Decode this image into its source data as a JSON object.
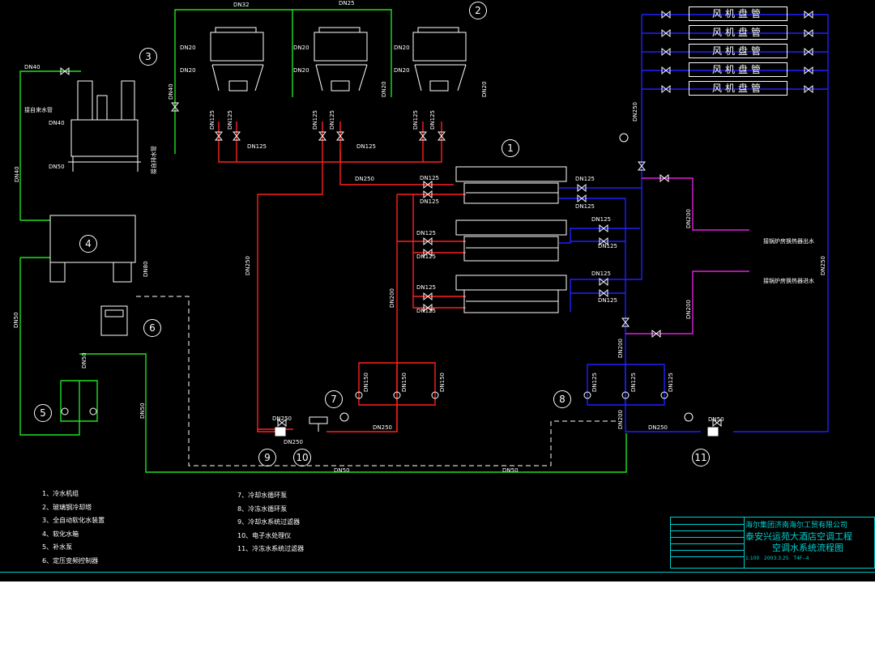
{
  "pipe_colors": {
    "cooling": "#ff2020",
    "chilled": "#2020ff",
    "makeup": "#20e020",
    "heat_exchanger": "#e020e0",
    "control": "#ffffff"
  },
  "pipe_labels": {
    "dn32": "DN32",
    "dn25_top": "DN25",
    "dn40_a": "DN40",
    "dn20_a": "DN20",
    "dn20_b": "DN20",
    "dn20_c": "DN20",
    "dn20_d": "DN20",
    "dn20_e": "DN20",
    "dn20_f": "DN20",
    "dn40_b": "DN40",
    "dn125_a": "DN125",
    "dn125_b": "DN125",
    "dn125_c": "DN125",
    "dn125_d": "DN125",
    "dn125_e": "DN125",
    "dn125_f": "DN125",
    "dn125_h1": "DN125",
    "dn125_h2": "DN125",
    "dn250_a": "DN250",
    "dn250_v": "DN250",
    "dn200_v": "DN200",
    "dn125_ch1": "DN125",
    "dn125_ch2": "DN125",
    "dn125_ch3": "DN125",
    "dn125_ch4": "DN125",
    "dn125_ch5": "DN125",
    "dn125_ch6": "DN125",
    "dn125_cw1": "DN125",
    "dn125_cw2": "DN125",
    "dn125_cw3": "DN125",
    "dn125_cw4": "DN125",
    "dn125_cw5": "DN125",
    "dn125_cw6": "DN125",
    "dn250_b": "DN250",
    "dn250_c": "DN250",
    "dn250_d": "DN250",
    "dn250_e": "DN250",
    "dn250_f": "DN250",
    "dn200_a": "DN200",
    "dn200_b": "DN200",
    "dn200_c": "DN200",
    "dn200_d": "DN200",
    "dn250_right": "DN250",
    "dn150_a": "DN150",
    "dn150_b": "DN150",
    "dn150_c": "DN150",
    "dn125_p1": "DN125",
    "dn125_p2": "DN125",
    "dn125_p3": "DN125",
    "dn50_a": "DN50",
    "dn50_b": "DN50",
    "dn50_c": "DN50",
    "dn50_d": "DN50",
    "dn50_e": "DN50",
    "dn40_c": "DN40",
    "dn40_d": "DN40",
    "dn50_f": "DN50",
    "dn20_g": "DN20",
    "dn20_h": "DN20",
    "dn80": "DN80",
    "dn50_g": "DN50"
  },
  "annotations": {
    "city_water": "接自来水管",
    "drain": "接自排水管",
    "boiler_out": "接锅炉房换热器出水",
    "boiler_in": "接锅炉房换热器进水"
  },
  "fan_coil_label": "风机盘管",
  "fan_coils": [
    "风机盘管",
    "风机盘管",
    "风机盘管",
    "风机盘管",
    "风机盘管"
  ],
  "callouts": [
    "1",
    "2",
    "3",
    "4",
    "5",
    "6",
    "7",
    "8",
    "9",
    "10",
    "11"
  ],
  "legend": [
    "1、冷水机组",
    "2、玻璃钢冷却塔",
    "3、全自动软化水装置",
    "4、软化水箱",
    "5、补水泵",
    "6、定压变频控制器",
    "7、冷却水循环泵",
    "8、冷冻水循环泵",
    "9、冷却水系统过滤器",
    "10、电子水处理仪",
    "11、冷冻水系统过滤器"
  ],
  "title_block": {
    "company": "海尔集团济南海尔工贸有限公司",
    "project": "泰安兴运苑大酒店空调工程",
    "drawing": "空调水系统流程图",
    "drawing_no": "T4F--4",
    "date": "2003.3.25",
    "scale": "1:100"
  }
}
